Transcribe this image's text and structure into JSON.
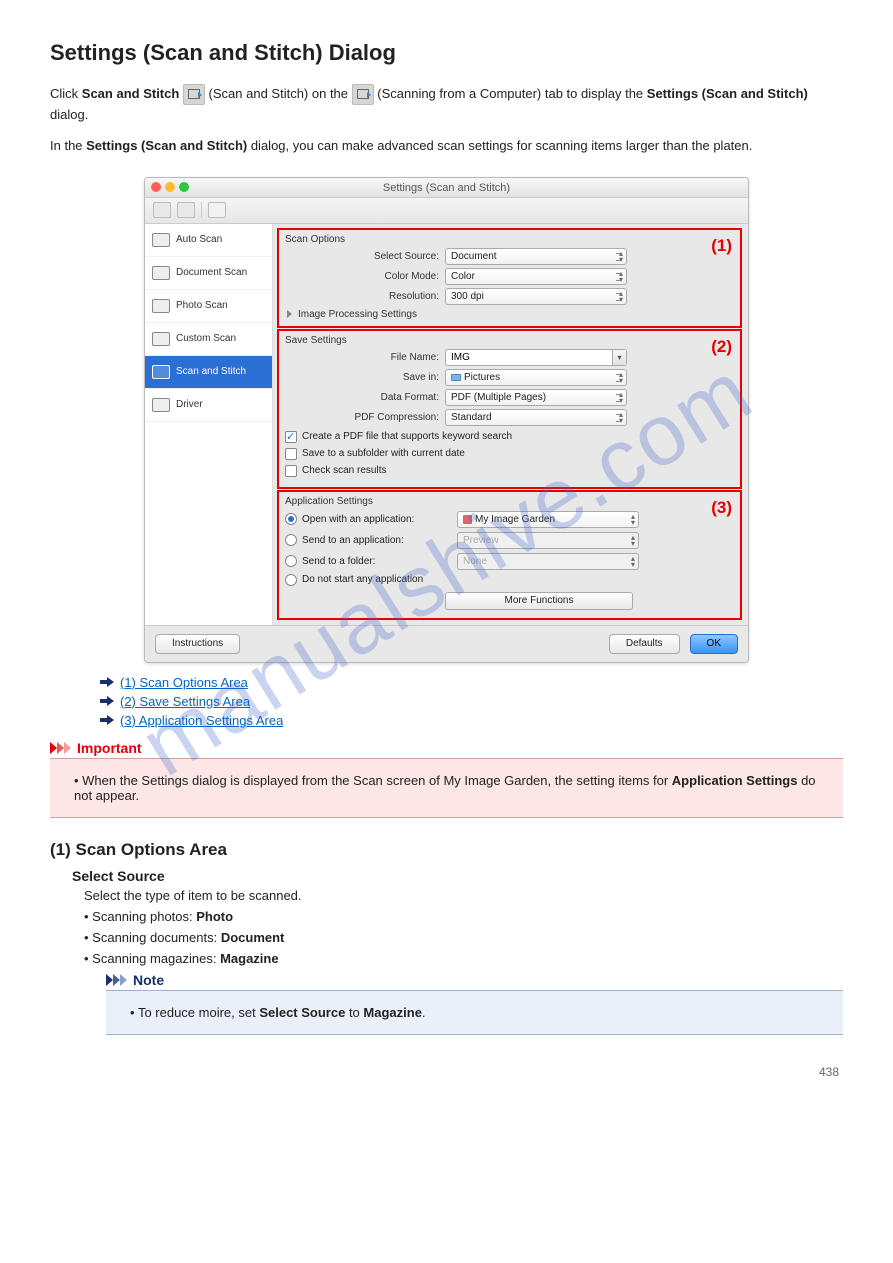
{
  "page_title": "Settings (Scan and Stitch) Dialog",
  "intro_pre": "Click ",
  "intro_mid": " (Scan and Stitch) on the ",
  "intro_tab": " (Scanning from a Computer) tab to display the ",
  "intro_dialog": "Settings (Scan and Stitch)",
  "intro_end": " dialog.",
  "scan_stitch_label": "Scan and Stitch",
  "para2": "In the Settings (Scan and Stitch) dialog, you can make advanced scan settings for scanning items larger than the platen.",
  "window": {
    "title": "Settings (Scan and Stitch)",
    "sidebar": [
      "Auto Scan",
      "Document Scan",
      "Photo Scan",
      "Custom Scan",
      "Scan and Stitch",
      "Driver"
    ],
    "scan_options": {
      "heading": "Scan Options",
      "select_source_label": "Select Source:",
      "select_source_value": "Document",
      "color_mode_label": "Color Mode:",
      "color_mode_value": "Color",
      "resolution_label": "Resolution:",
      "resolution_value": "300 dpi",
      "image_processing": "Image Processing Settings",
      "callout": "(1)"
    },
    "save_settings": {
      "heading": "Save Settings",
      "file_name_label": "File Name:",
      "file_name_value": "IMG",
      "save_in_label": "Save in:",
      "save_in_value": "Pictures",
      "data_format_label": "Data Format:",
      "data_format_value": "PDF (Multiple Pages)",
      "pdf_comp_label": "PDF Compression:",
      "pdf_comp_value": "Standard",
      "chk1": "Create a PDF file that supports keyword search",
      "chk2": "Save to a subfolder with current date",
      "chk3": "Check scan results",
      "callout": "(2)"
    },
    "app_settings": {
      "heading": "Application Settings",
      "r1": "Open with an application:",
      "r1_val": "My Image Garden",
      "r2": "Send to an application:",
      "r2_val": "Preview",
      "r3": "Send to a folder:",
      "r3_val": "None",
      "r4": "Do not start any application",
      "more": "More Functions",
      "callout": "(3)"
    },
    "footer": {
      "instructions": "Instructions",
      "defaults": "Defaults",
      "ok": "OK"
    }
  },
  "links": [
    "(1) Scan Options Area",
    "(2) Save Settings Area",
    "(3) Application Settings Area"
  ],
  "important_title": "Important",
  "important_body": "When the Settings dialog is displayed from the Scan screen of My Image Garden, the setting items for Application Settings do not appear.",
  "h2": "(1) Scan Options Area",
  "def1_term": "Select Source",
  "def1_body": "Select the type of item to be scanned.",
  "def1_l1": "Scanning photos: Photo",
  "def1_l2": "Scanning documents: Document",
  "def1_l3": "Scanning magazines: Magazine",
  "note_title": "Note",
  "note_body_pre": "To reduce moire, set ",
  "note_body_strong": "Select Source",
  "note_body_mid": " to ",
  "note_body_strong2": "Magazine",
  "note_body_end": ".",
  "watermark": "manualshive.com",
  "pagenum": "438"
}
